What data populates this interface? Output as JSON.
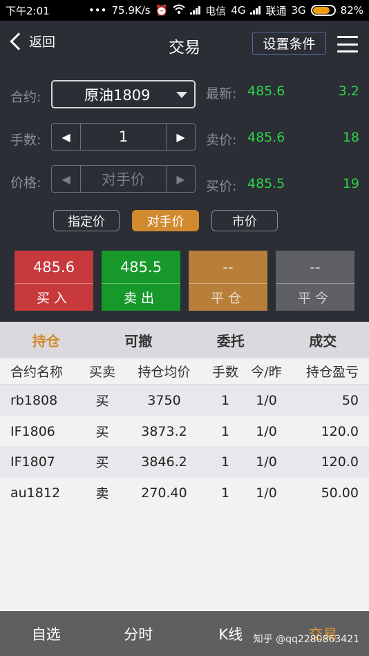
{
  "status_bar": {
    "time": "下午2:01",
    "dots": "•••",
    "speed": "75.9K/s",
    "carrier1": "电信",
    "net1": "4G",
    "carrier2": "联通",
    "net2": "3G",
    "battery": "82%"
  },
  "nav": {
    "back_label": "返回",
    "title": "交易",
    "condition_label": "设置条件"
  },
  "form": {
    "contract_label": "合约:",
    "contract_value": "原油1809",
    "lots_label": "手数:",
    "lots_value": "1",
    "price_label": "价格:",
    "price_value": "对手价"
  },
  "quotes": [
    {
      "label": "最新:",
      "price": "485.6",
      "volume": "3.2"
    },
    {
      "label": "卖价:",
      "price": "485.6",
      "volume": "18"
    },
    {
      "label": "买价:",
      "price": "485.5",
      "volume": "19"
    }
  ],
  "price_types": [
    "指定价",
    "对手价",
    "市价"
  ],
  "trade_buttons": [
    {
      "price": "485.6",
      "action": "买入"
    },
    {
      "price": "485.5",
      "action": "卖出"
    },
    {
      "price": "--",
      "action": "平仓"
    },
    {
      "price": "--",
      "action": "平今"
    }
  ],
  "tabs": [
    "持仓",
    "可撤",
    "委托",
    "成交"
  ],
  "table": {
    "headers": [
      "合约名称",
      "买卖",
      "持仓均价",
      "手数",
      "今/昨",
      "持仓盈亏"
    ],
    "rows": [
      [
        "rb1808",
        "买",
        "3750",
        "1",
        "1/0",
        "50"
      ],
      [
        "IF1806",
        "买",
        "3873.2",
        "1",
        "1/0",
        "120.0"
      ],
      [
        "IF1807",
        "买",
        "3846.2",
        "1",
        "1/0",
        "120.0"
      ],
      [
        "au1812",
        "卖",
        "270.40",
        "1",
        "1/0",
        "50.00"
      ]
    ]
  },
  "bottom_nav": [
    "自选",
    "分时",
    "K线",
    "交易"
  ],
  "watermark": "知乎 @qq2280863421",
  "colors": {
    "accent": "#d18a2e",
    "quote_green": "#2ed34a",
    "buy_red": "#c8393c",
    "sell_green": "#17982b"
  }
}
